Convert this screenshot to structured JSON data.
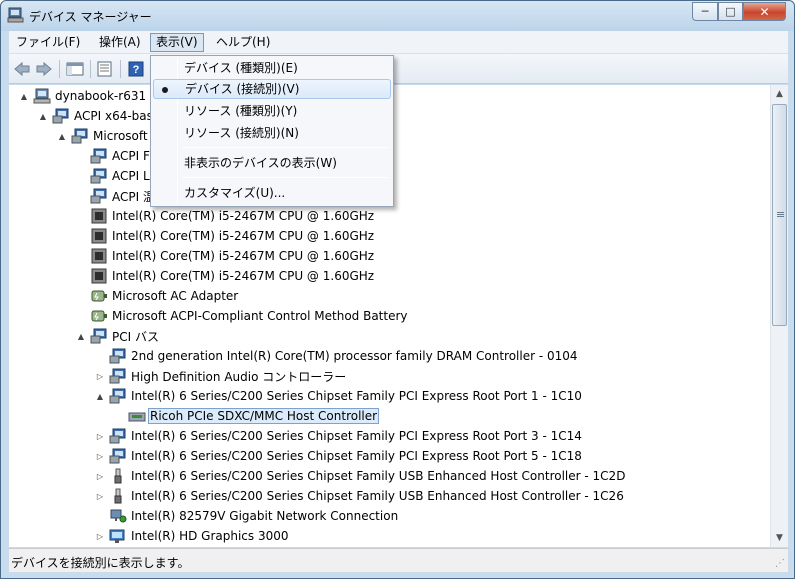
{
  "window": {
    "title": "デバイス マネージャー"
  },
  "caption": {
    "minimize": "─",
    "maximize": "□",
    "close": "✕"
  },
  "menubar": {
    "file": "ファイル(F)",
    "action": "操作(A)",
    "view": "表示(V)",
    "help": "ヘルプ(H)"
  },
  "toolbar": {
    "icons": [
      "back-icon",
      "forward-icon",
      "console-tree-icon",
      "properties-icon",
      "help-icon"
    ]
  },
  "view_menu": {
    "items": [
      {
        "label": "デバイス (種類別)(E)",
        "checked": false
      },
      {
        "label": "デバイス (接続別)(V)",
        "checked": true
      },
      {
        "label": "リソース (種類別)(Y)",
        "checked": false
      },
      {
        "label": "リソース (接続別)(N)",
        "checked": false
      },
      {
        "label": "非表示のデバイスの表示(W)",
        "checked": false
      },
      {
        "label": "カスタマイズ(U)...",
        "checked": false
      }
    ]
  },
  "tree": {
    "rows": [
      {
        "label": "dynabook-r631",
        "icon": "computer-icon",
        "expander": "▲"
      },
      {
        "label": "ACPI x64-bas",
        "icon": "monitor-icon",
        "expander": "▲"
      },
      {
        "label": "Microsoft A",
        "icon": "monitor-icon",
        "expander": "▲"
      },
      {
        "label": "ACPI F",
        "icon": "monitor-icon",
        "expander": ""
      },
      {
        "label": "ACPI L",
        "icon": "monitor-icon",
        "expander": ""
      },
      {
        "label": "ACPI 温",
        "icon": "monitor-icon",
        "expander": ""
      },
      {
        "label": "Intel(R) Core(TM) i5-2467M CPU @ 1.60GHz",
        "icon": "cpu-icon",
        "expander": ""
      },
      {
        "label": "Intel(R) Core(TM) i5-2467M CPU @ 1.60GHz",
        "icon": "cpu-icon",
        "expander": ""
      },
      {
        "label": "Intel(R) Core(TM) i5-2467M CPU @ 1.60GHz",
        "icon": "cpu-icon",
        "expander": ""
      },
      {
        "label": "Intel(R) Core(TM) i5-2467M CPU @ 1.60GHz",
        "icon": "cpu-icon",
        "expander": ""
      },
      {
        "label": "Microsoft AC Adapter",
        "icon": "battery-icon",
        "expander": ""
      },
      {
        "label": "Microsoft ACPI-Compliant Control Method Battery",
        "icon": "battery-icon",
        "expander": ""
      },
      {
        "label": "PCI バス",
        "icon": "monitor-icon",
        "expander": "▲"
      },
      {
        "label": "2nd generation Intel(R) Core(TM) processor family DRAM Controller - 0104",
        "icon": "monitor-icon",
        "expander": ""
      },
      {
        "label": "High Definition Audio コントローラー",
        "icon": "monitor-icon",
        "expander": "▷"
      },
      {
        "label": "Intel(R) 6 Series/C200 Series Chipset Family PCI Express Root Port 1 - 1C10",
        "icon": "monitor-icon",
        "expander": "▲"
      },
      {
        "label": "Ricoh PCIe SDXC/MMC Host Controller",
        "icon": "card-reader-icon",
        "expander": "",
        "selected": true
      },
      {
        "label": "Intel(R) 6 Series/C200 Series Chipset Family PCI Express Root Port 3 - 1C14",
        "icon": "monitor-icon",
        "expander": "▷"
      },
      {
        "label": "Intel(R) 6 Series/C200 Series Chipset Family PCI Express Root Port 5 - 1C18",
        "icon": "monitor-icon",
        "expander": "▷"
      },
      {
        "label": "Intel(R) 6 Series/C200 Series Chipset Family USB Enhanced Host Controller - 1C2D",
        "icon": "usb-icon",
        "expander": "▷"
      },
      {
        "label": "Intel(R) 6 Series/C200 Series Chipset Family USB Enhanced Host Controller - 1C26",
        "icon": "usb-icon",
        "expander": "▷"
      },
      {
        "label": "Intel(R) 82579V Gigabit Network Connection",
        "icon": "network-icon",
        "expander": ""
      },
      {
        "label": "Intel(R) HD Graphics 3000",
        "icon": "display-icon",
        "expander": "▷"
      }
    ]
  },
  "status": {
    "text": "デバイスを接続別に表示します。"
  },
  "colors": {
    "selection": "#dcebfc",
    "close_button": "#c8452c"
  }
}
